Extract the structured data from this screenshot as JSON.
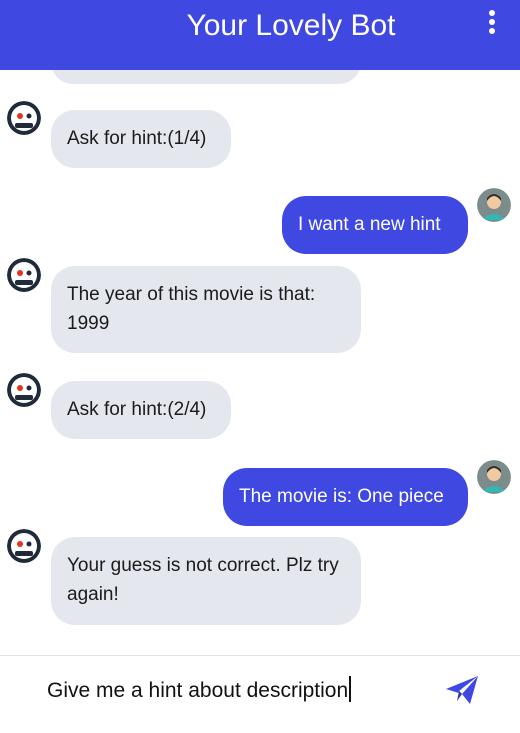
{
  "header": {
    "title": "Your Lovely Bot",
    "menu_icon": "more-vertical-icon"
  },
  "colors": {
    "accent": "#3f48e0",
    "bot_bubble": "#e4e7ee",
    "user_bubble": "#3f48e0"
  },
  "messages": [
    {
      "sender": "bot",
      "text": "Ask for hint:(1/4)"
    },
    {
      "sender": "user",
      "text": "I want a new hint"
    },
    {
      "sender": "bot",
      "text": "The year of this movie is that: 1999"
    },
    {
      "sender": "bot",
      "text": "Ask for hint:(2/4)"
    },
    {
      "sender": "user",
      "text": "The movie is: One piece"
    },
    {
      "sender": "bot",
      "text": "Your guess is not correct. Plz try again!"
    }
  ],
  "composer": {
    "value": "Give me a hint about description",
    "send_icon": "paper-plane-icon"
  }
}
